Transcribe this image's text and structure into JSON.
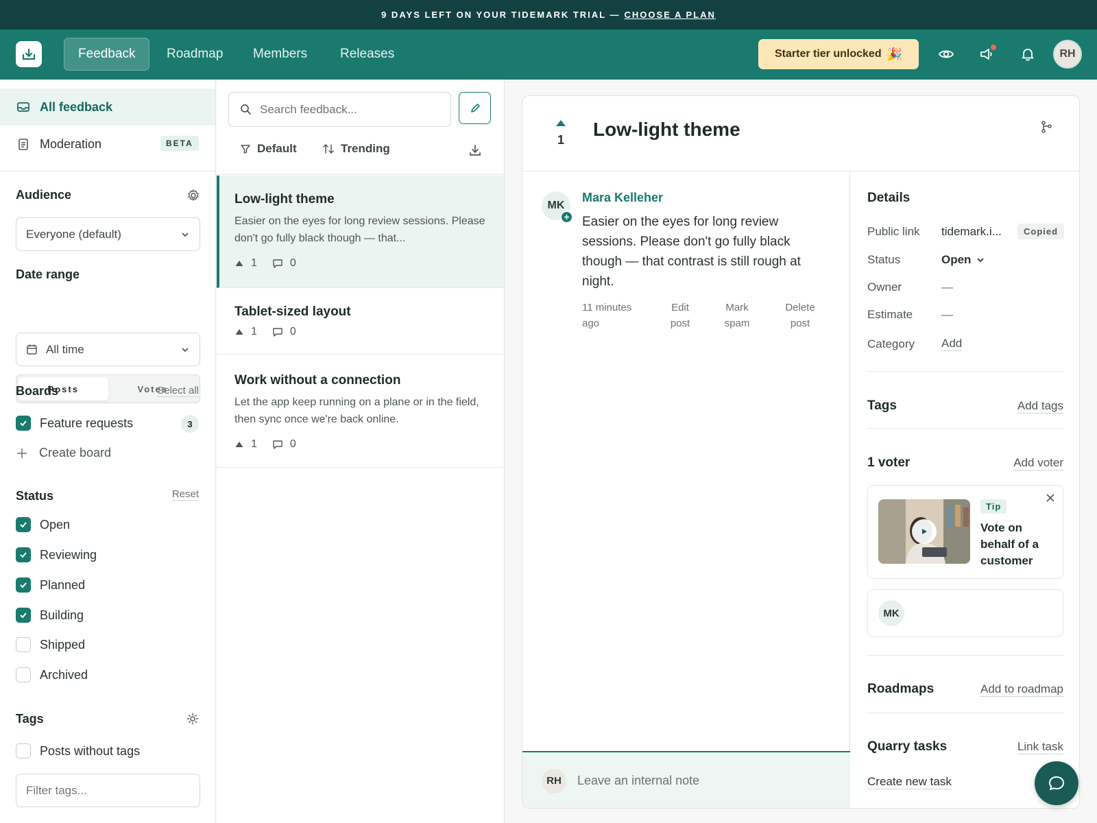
{
  "banner": {
    "text": "9 DAYS LEFT ON YOUR TIDEMARK TRIAL —",
    "link": "CHOOSE A PLAN"
  },
  "nav": {
    "tabs": [
      {
        "label": "Feedback"
      },
      {
        "label": "Roadmap"
      },
      {
        "label": "Members"
      },
      {
        "label": "Releases"
      }
    ],
    "starter": "Starter tier unlocked",
    "user_initials": "RH"
  },
  "sidebar": {
    "all_feedback": "All feedback",
    "moderation": "Moderation",
    "beta": "BETA",
    "audience_title": "Audience",
    "audience_value": "Everyone (default)",
    "date_range_title": "Date range",
    "seg_posts": "Posts",
    "seg_votes": "Votes",
    "date_value": "All time",
    "boards_title": "Boards",
    "select_all": "Select all",
    "board": {
      "label": "Feature requests",
      "count": "3"
    },
    "create_board": "Create board",
    "status_title": "Status",
    "reset": "Reset",
    "statuses": [
      {
        "label": "Open",
        "checked": true
      },
      {
        "label": "Reviewing",
        "checked": true
      },
      {
        "label": "Planned",
        "checked": true
      },
      {
        "label": "Building",
        "checked": true
      },
      {
        "label": "Shipped",
        "checked": false
      },
      {
        "label": "Archived",
        "checked": false
      }
    ],
    "tags_title": "Tags",
    "posts_without_tags": "Posts without tags",
    "filter_placeholder": "Filter tags..."
  },
  "list": {
    "search_placeholder": "Search feedback...",
    "default_label": "Default",
    "trending_label": "Trending",
    "posts": [
      {
        "title": "Low-light theme",
        "excerpt": "Easier on the eyes for long review sessions. Please don't go fully black though — that...",
        "votes": "1",
        "comments": "0"
      },
      {
        "title": "Tablet-sized layout",
        "excerpt": "",
        "votes": "1",
        "comments": "0"
      },
      {
        "title": "Work without a connection",
        "excerpt": "Let the app keep running on a plane or in the field, then sync once we're back online.",
        "votes": "1",
        "comments": "0"
      }
    ]
  },
  "detail": {
    "votes": "1",
    "title": "Low-light theme",
    "author_initials": "MK",
    "author": "Mara Kelleher",
    "body": "Easier on the eyes for long review sessions. Please don't go fully black though — that contrast is still rough at night.",
    "time": "11 minutes ago",
    "edit": "Edit post",
    "spam": "Mark spam",
    "delete": "Delete post",
    "note_initials": "RH",
    "note_placeholder": "Leave an internal note"
  },
  "details_panel": {
    "title": "Details",
    "public_link_label": "Public link",
    "public_link_value": "tidemark.i...",
    "copied": "Copied",
    "status_label": "Status",
    "status_value": "Open",
    "owner_label": "Owner",
    "owner_value": "—",
    "estimate_label": "Estimate",
    "estimate_value": "—",
    "category_label": "Category",
    "category_value": "Add",
    "tags_title": "Tags",
    "add_tags": "Add tags",
    "voters_title": "1 voter",
    "add_voter": "Add voter",
    "tip_badge": "Tip",
    "tip_text": "Vote on behalf of a customer",
    "voter_initials": "MK",
    "roadmaps_title": "Roadmaps",
    "add_to_roadmap": "Add to roadmap",
    "quarry_title": "Quarry tasks",
    "link_task": "Link task",
    "create_task": "Create new task"
  },
  "colors": {
    "accent": "#1a7a6e",
    "banner": "#134142",
    "starter": "#fde7b8"
  }
}
